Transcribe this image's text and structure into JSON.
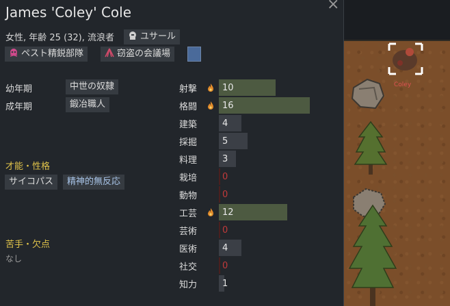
{
  "header": {
    "name": "James 'Coley' Cole",
    "close": "×",
    "subtitle": "女性, 年齢 25 (32), 流浪者",
    "role": "ユサール"
  },
  "factions": [
    {
      "label": "ペスト精鋭部隊",
      "icon": "skull-icon",
      "color": "#d14a8c"
    },
    {
      "label": "窃盗の会議場",
      "icon": "tent-icon",
      "color": "#d24a6a"
    }
  ],
  "faction_color": "#4a6a9a",
  "backstory": {
    "childhood_label": "幼年期",
    "childhood_value": "中世の奴隷",
    "adulthood_label": "成年期",
    "adulthood_value": "鍛冶職人"
  },
  "traits": {
    "heading": "才能・性格",
    "items": [
      "サイコパス",
      "精神的無反応"
    ]
  },
  "incapable": {
    "heading": "苦手・欠点",
    "value": "なし"
  },
  "skills": [
    {
      "name": "射撃",
      "level": 10,
      "passion": true
    },
    {
      "name": "格闘",
      "level": 16,
      "passion": true
    },
    {
      "name": "建築",
      "level": 4,
      "passion": false
    },
    {
      "name": "採掘",
      "level": 5,
      "passion": false
    },
    {
      "name": "料理",
      "level": 3,
      "passion": false
    },
    {
      "name": "栽培",
      "level": 0,
      "passion": false
    },
    {
      "name": "動物",
      "level": 0,
      "passion": false
    },
    {
      "name": "工芸",
      "level": 12,
      "passion": true
    },
    {
      "name": "芸術",
      "level": 0,
      "passion": false
    },
    {
      "name": "医術",
      "level": 4,
      "passion": false
    },
    {
      "name": "社交",
      "level": 0,
      "passion": false
    },
    {
      "name": "知力",
      "level": 1,
      "passion": false
    }
  ],
  "map": {
    "pawn_label": "Coley"
  }
}
